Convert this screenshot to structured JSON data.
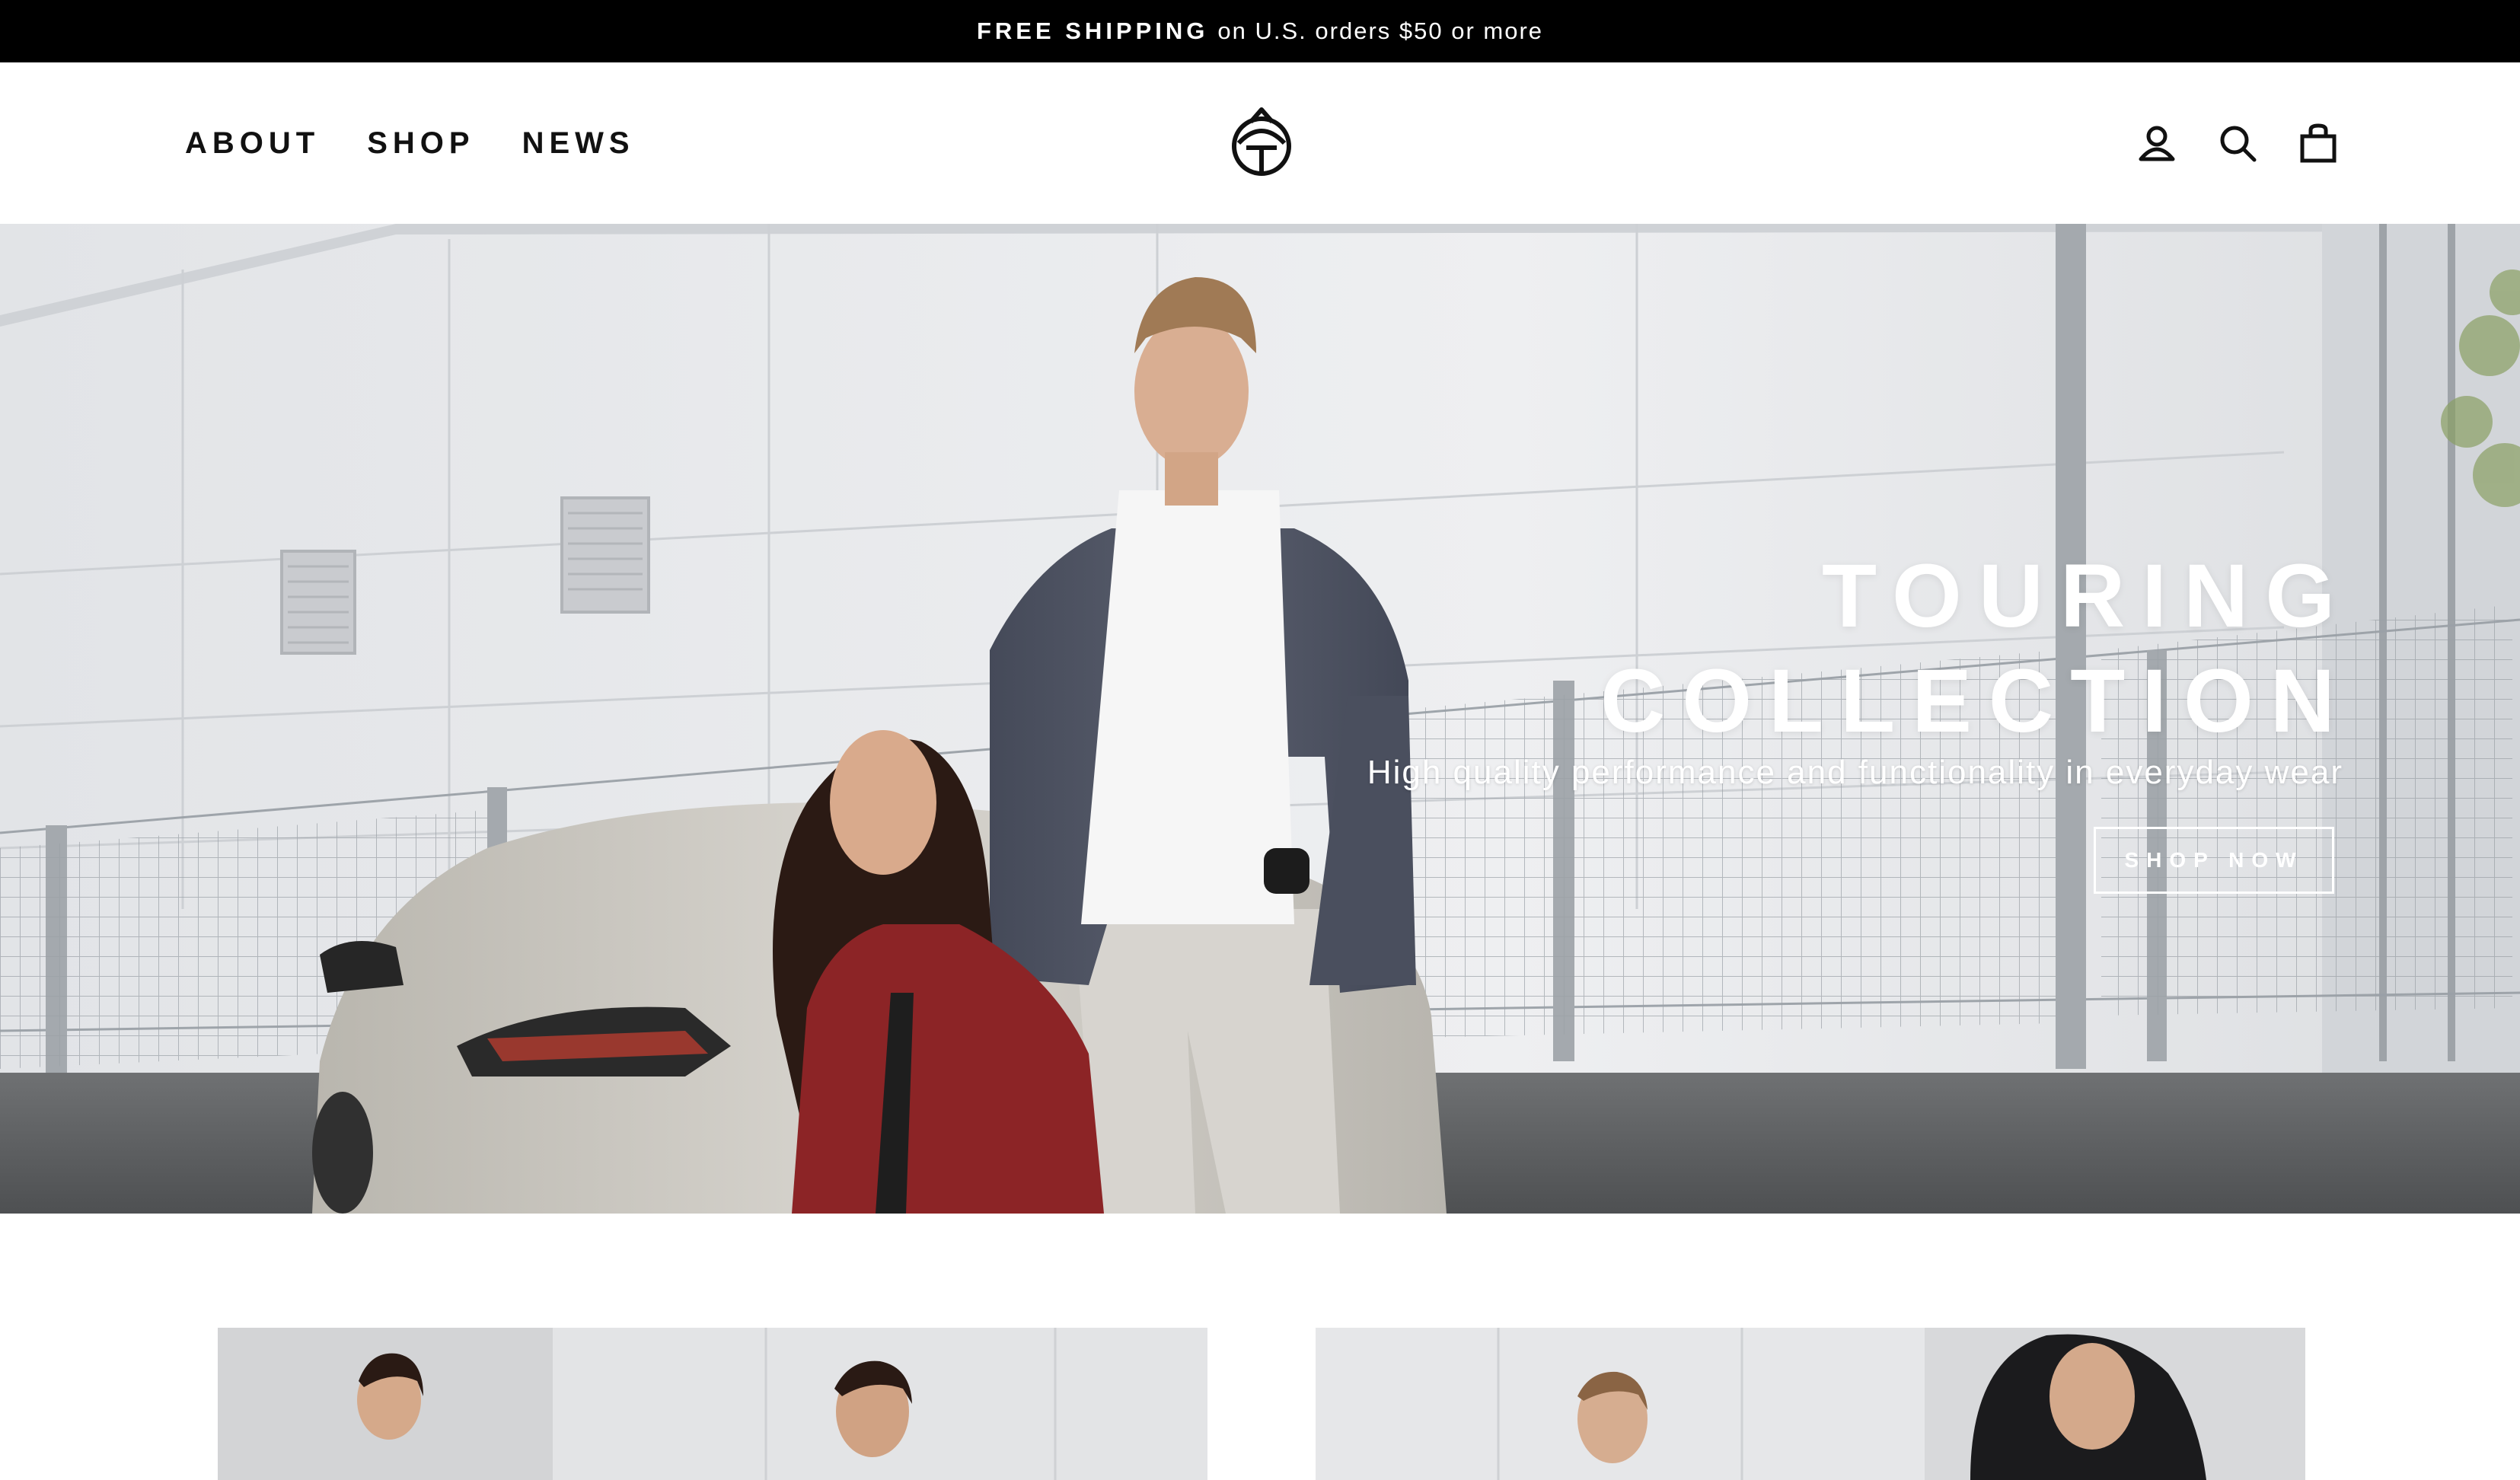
{
  "announcement": {
    "bold": "FREE SHIPPING",
    "rest": "on U.S. orders $50 or more"
  },
  "nav": {
    "about": "ABOUT",
    "shop": "SHOP",
    "news": "NEWS"
  },
  "header_icons": [
    "account-icon",
    "search-icon",
    "cart-icon"
  ],
  "hero": {
    "title_line1": "TOURING",
    "title_line2": "COLLECTION",
    "subtitle": "High quality performance and functionality in everyday wear",
    "cta": "SHOP NOW"
  },
  "colors": {
    "announcement_bg": "#000000",
    "text": "#111111",
    "hero_text": "#ffffff",
    "jacket": "#4f5464",
    "red_shirt": "#8c2426"
  }
}
